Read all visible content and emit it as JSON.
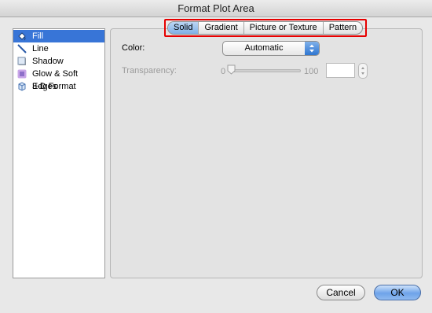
{
  "window": {
    "title": "Format Plot Area"
  },
  "sidebar": {
    "items": [
      {
        "label": "Fill",
        "icon": "paint-bucket-icon",
        "selected": true
      },
      {
        "label": "Line",
        "icon": "line-icon",
        "selected": false
      },
      {
        "label": "Shadow",
        "icon": "shadow-icon",
        "selected": false
      },
      {
        "label": "Glow & Soft Edges",
        "icon": "glow-icon",
        "selected": false
      },
      {
        "label": "3-D Format",
        "icon": "cube-icon",
        "selected": false
      }
    ]
  },
  "tabs": [
    {
      "label": "Solid",
      "active": true
    },
    {
      "label": "Gradient",
      "active": false
    },
    {
      "label": "Picture or Texture",
      "active": false
    },
    {
      "label": "Pattern",
      "active": false
    }
  ],
  "fill": {
    "color_label": "Color:",
    "color_value": "Automatic",
    "transparency_label": "Transparency:",
    "slider_min": "0",
    "slider_max": "100",
    "slider_value": 0,
    "transparency_value": ""
  },
  "buttons": {
    "cancel": "Cancel",
    "ok": "OK"
  },
  "colors": {
    "selection": "#3875d7",
    "highlight_box": "#e60000",
    "default_button": "#6ea3e9"
  }
}
